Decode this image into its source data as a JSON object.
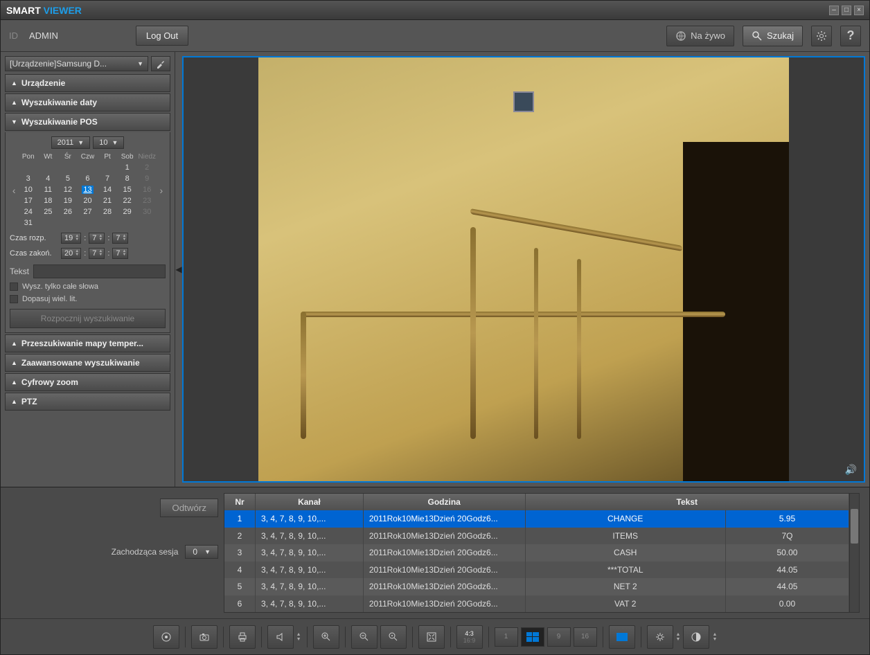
{
  "app": {
    "title_part1": "SMART",
    "title_part2": "VIEWER"
  },
  "topbar": {
    "id_label": "ID",
    "id_value": "ADMIN",
    "logout": "Log Out",
    "live": "Na żywo",
    "search": "Szukaj"
  },
  "sidebar": {
    "device_selected": "[Urządzenie]Samsung D...",
    "sections": {
      "device": "Urządzenie",
      "date_search": "Wyszukiwanie daty",
      "pos_search": "Wyszukiwanie POS",
      "heatmap": "Przeszukiwanie mapy temper...",
      "advanced": "Zaawansowane wyszukiwanie",
      "zoom": "Cyfrowy zoom",
      "ptz": "PTZ"
    },
    "calendar": {
      "year": "2011",
      "month": "10",
      "days": [
        "Pon",
        "Wt",
        "Śr",
        "Czw",
        "Pt",
        "Sob",
        "Niedz"
      ],
      "selected_day": "13"
    },
    "time_start_label": "Czas rozp.",
    "time_end_label": "Czas zakoń.",
    "time_start": [
      "19",
      "7",
      "7"
    ],
    "time_end": [
      "20",
      "7",
      "7"
    ],
    "text_label": "Tekst",
    "text_value": "",
    "whole_words": "Wysz. tylko całe słowa",
    "match_case": "Dopasuj wiel. lit.",
    "start_search": "Rozpocznij wyszukiwanie"
  },
  "results": {
    "play": "Odtwórz",
    "session_label": "Zachodząca sesja",
    "session_value": "0",
    "columns": {
      "nr": "Nr",
      "channel": "Kanał",
      "time": "Godzina",
      "text": "Tekst"
    },
    "rows": [
      {
        "nr": "1",
        "ch": "3, 4, 7, 8, 9, 10,...",
        "time": "2011Rok10Mie13Dzień 20Godz6...",
        "t1": "CHANGE",
        "t2": "5.95"
      },
      {
        "nr": "2",
        "ch": "3, 4, 7, 8, 9, 10,...",
        "time": "2011Rok10Mie13Dzień 20Godz6...",
        "t1": "ITEMS",
        "t2": "7Q"
      },
      {
        "nr": "3",
        "ch": "3, 4, 7, 8, 9, 10,...",
        "time": "2011Rok10Mie13Dzień 20Godz6...",
        "t1": "CASH",
        "t2": "50.00"
      },
      {
        "nr": "4",
        "ch": "3, 4, 7, 8, 9, 10,...",
        "time": "2011Rok10Mie13Dzień 20Godz6...",
        "t1": "***TOTAL",
        "t2": "44.05"
      },
      {
        "nr": "5",
        "ch": "3, 4, 7, 8, 9, 10,...",
        "time": "2011Rok10Mie13Dzień 20Godz6...",
        "t1": "NET 2",
        "t2": "44.05"
      },
      {
        "nr": "6",
        "ch": "3, 4, 7, 8, 9, 10,...",
        "time": "2011Rok10Mie13Dzień 20Godz6...",
        "t1": "VAT 2",
        "t2": "0.00"
      }
    ]
  },
  "toolbar": {
    "ratio_active": "4:3",
    "ratio_inactive": "16:9",
    "layouts": [
      "1",
      "4",
      "9",
      "16"
    ]
  }
}
